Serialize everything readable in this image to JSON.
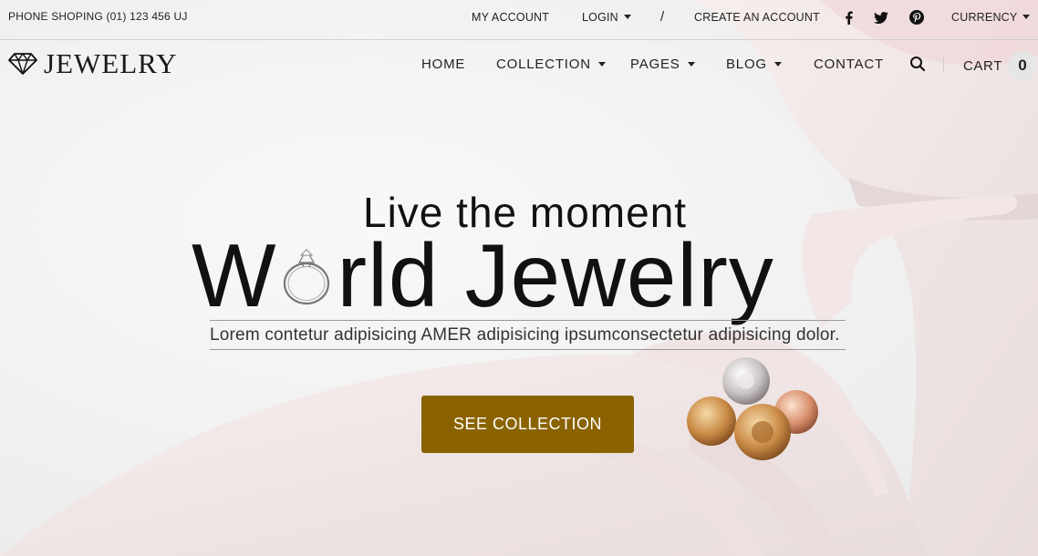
{
  "topbar": {
    "phone": "PHONE SHOPING (01) 123 456 UJ",
    "my_account": "MY ACCOUNT",
    "login": "LOGIN",
    "separator": "/",
    "create_account": "CREATE AN ACCOUNT",
    "social": [
      "facebook-icon",
      "twitter-icon",
      "pinterest-icon"
    ],
    "currency": "CURRENCY"
  },
  "nav": {
    "logo": "JEWELRY",
    "home": "HOME",
    "collection": "COLLECTION",
    "pages": "PAGES",
    "blog": "BLOG",
    "contact": "CONTACT",
    "cart_label": "CART",
    "cart_count": "0"
  },
  "hero": {
    "tagline": "Live the moment",
    "headline_before": "W",
    "headline_after": "rld Jewelry",
    "subline": "Lorem contetur adipisicing AMER adipisicing ipsumconsectetur adipisicing dolor.",
    "cta": "SEE COLLECTION"
  },
  "colors": {
    "accent": "#8a6300",
    "text": "#222222",
    "background": "#f3f3f3"
  }
}
